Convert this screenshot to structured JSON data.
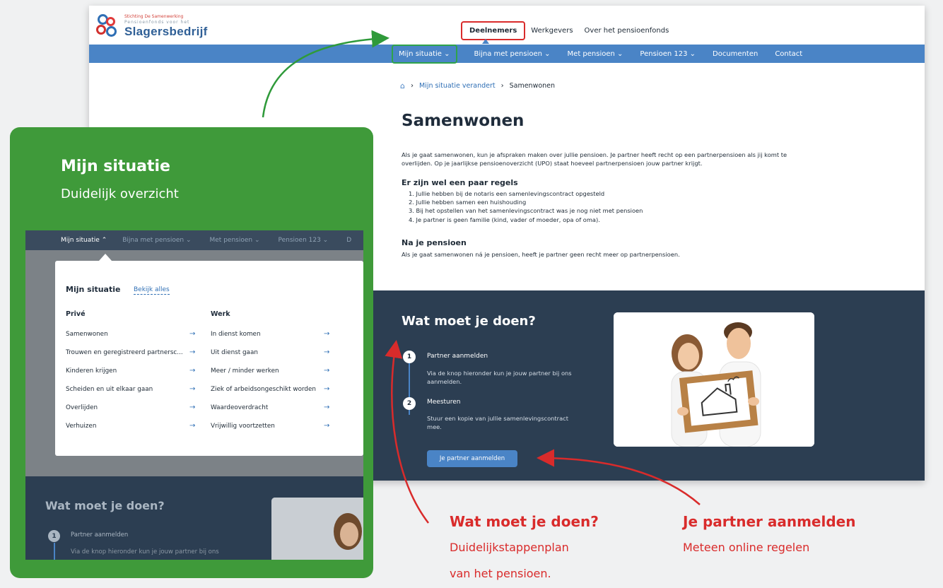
{
  "logo": {
    "line1": "Stichting De Samenwerking",
    "line2": "Pensioenfonds voor het",
    "name": "Slagersbedrijf"
  },
  "topnav": [
    "Deelnemers",
    "Werkgevers",
    "Over het pensioenfonds"
  ],
  "mainnav": [
    "Mijn situatie ⌄",
    "Bijna met pensioen ⌄",
    "Met pensioen ⌄",
    "Pensioen 123 ⌄",
    "Documenten",
    "Contact"
  ],
  "breadcrumb": {
    "home": "⌂",
    "sep": "›",
    "link": "Mijn situatie verandert",
    "current": "Samenwonen"
  },
  "article": {
    "title": "Samenwonen",
    "intro": "Als je gaat samenwonen, kun je afspraken maken over jullie pensioen. Je partner heeft recht op een partnerpensioen als jij komt te overlijden. Op je jaarlijkse pensioenoverzicht (UPO) staat hoeveel partnerpensioen jouw partner krijgt.",
    "rules_title": "Er zijn wel een paar regels",
    "rules": [
      "1.  Jullie hebben bij de notaris een samenlevingscontract opgesteld",
      "2.  Jullie hebben samen een huishouding",
      "3.  Bij het opstellen van het samenlevingscontract was je nog niet met pensioen",
      "4.  Je partner is geen familie (kind, vader of moeder, opa of oma)."
    ],
    "after_title": "Na je pensioen",
    "after_text": "Als je gaat samenwonen ná je pensioen, heeft je partner geen recht meer op partnerpensioen."
  },
  "todo": {
    "title": "Wat moet je doen?",
    "steps": [
      {
        "num": "1",
        "title": "Partner aanmelden",
        "text": "Via de knop hieronder kun je jouw partner bij ons aanmelden."
      },
      {
        "num": "2",
        "title": "Meesturen",
        "text": "Stuur een kopie van jullie samenlevingscontract mee."
      }
    ],
    "cta": "Je partner aanmelden"
  },
  "callout": {
    "title": "Mijn situatie",
    "subtitle": "Duidelijk overzicht",
    "nav": [
      "Mijn situatie ⌃",
      "Bijna met pensioen ⌄",
      "Met pensioen ⌄",
      "Pensioen 123 ⌄",
      "D"
    ],
    "panel_title": "Mijn situatie",
    "panel_link": "Bekijk alles",
    "col1_title": "Privé",
    "col2_title": "Werk",
    "col1": [
      "Samenwonen",
      "Trouwen en geregistreerd partnersc...",
      "Kinderen krijgen",
      "Scheiden en uit elkaar gaan",
      "Overlijden",
      "Verhuizen"
    ],
    "col2": [
      "In dienst komen",
      "Uit dienst gaan",
      "Meer / minder werken",
      "Ziek of arbeidsongeschikt worden",
      "Waardeoverdracht",
      "Vrijwillig voortzetten"
    ],
    "arrow": "→",
    "dark_title": "Wat moet je doen?",
    "dark_num": "1",
    "dark_step": "Partner aanmelden",
    "dark_text": "Via de knop hieronder kun je jouw partner bij ons"
  },
  "annotations": {
    "a1_title": "Wat moet je doen?",
    "a1_line1": "Duidelijkstappenplan",
    "a1_line2": "van het pensioen.",
    "a2_title": "Je partner aanmelden",
    "a2_line1": "Meteen online regelen"
  },
  "colors": {
    "brand_blue": "#4a84c6",
    "dark_navy": "#2c3e52",
    "callout_green": "#3f9a3a",
    "annotation_red": "#d92b2b"
  }
}
